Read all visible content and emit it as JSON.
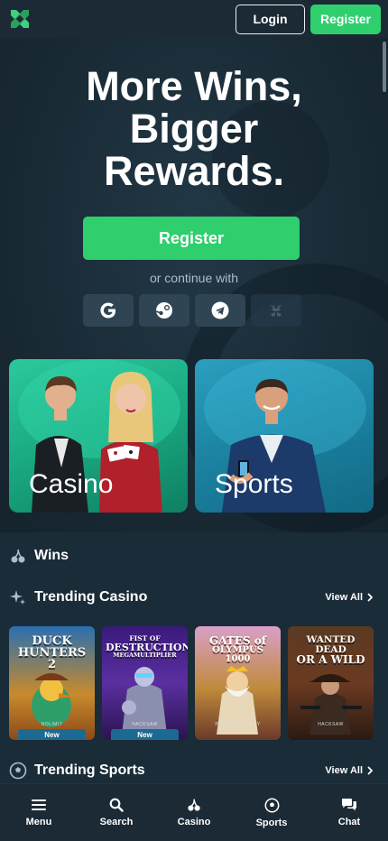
{
  "header": {
    "logo": "crossed-swords-logo",
    "login_label": "Login",
    "register_label": "Register"
  },
  "hero": {
    "title_lines": [
      "More Wins,",
      "Bigger",
      "Rewards."
    ],
    "register_label": "Register",
    "continue_text": "or continue with",
    "social": [
      "google-icon",
      "steam-icon",
      "telegram-icon",
      "metamask-icon"
    ]
  },
  "categories": [
    {
      "label": "Casino"
    },
    {
      "label": "Sports"
    }
  ],
  "sections": {
    "wins": {
      "title": "Wins"
    },
    "trending_casino": {
      "title": "Trending Casino",
      "view_all": "View All"
    },
    "trending_sports": {
      "title": "Trending Sports",
      "view_all": "View All"
    }
  },
  "games": [
    {
      "title_lines": [
        "DUCK",
        "HUNTERS 2"
      ],
      "provider": "NOLIMIT",
      "badge": "New",
      "bg": "#c98a2c"
    },
    {
      "title_lines": [
        "FIST OF",
        "DESTRUCTION",
        "MEGAMULTIPLIER"
      ],
      "provider": "HACKSAW",
      "badge": "New",
      "bg": "#5b2fa0"
    },
    {
      "title_lines": [
        "GATES of",
        "OLYMPUS 1000"
      ],
      "provider": "PRAGMATIC PLAY",
      "badge": "",
      "bg": "#c08a3a"
    },
    {
      "title_lines": [
        "WANTED DEAD",
        "OR A WILD"
      ],
      "provider": "HACKSAW",
      "badge": "",
      "bg": "#6b3a22"
    }
  ],
  "bottom_nav": [
    {
      "label": "Menu",
      "icon": "menu-icon"
    },
    {
      "label": "Search",
      "icon": "search-icon"
    },
    {
      "label": "Casino",
      "icon": "cherries-icon"
    },
    {
      "label": "Sports",
      "icon": "soccer-ball-icon"
    },
    {
      "label": "Chat",
      "icon": "chat-icon"
    }
  ],
  "colors": {
    "brand_green": "#2fcf6e",
    "background": "#1a2c38",
    "casino_card": "#1fb78c",
    "sports_card": "#2290b0"
  }
}
